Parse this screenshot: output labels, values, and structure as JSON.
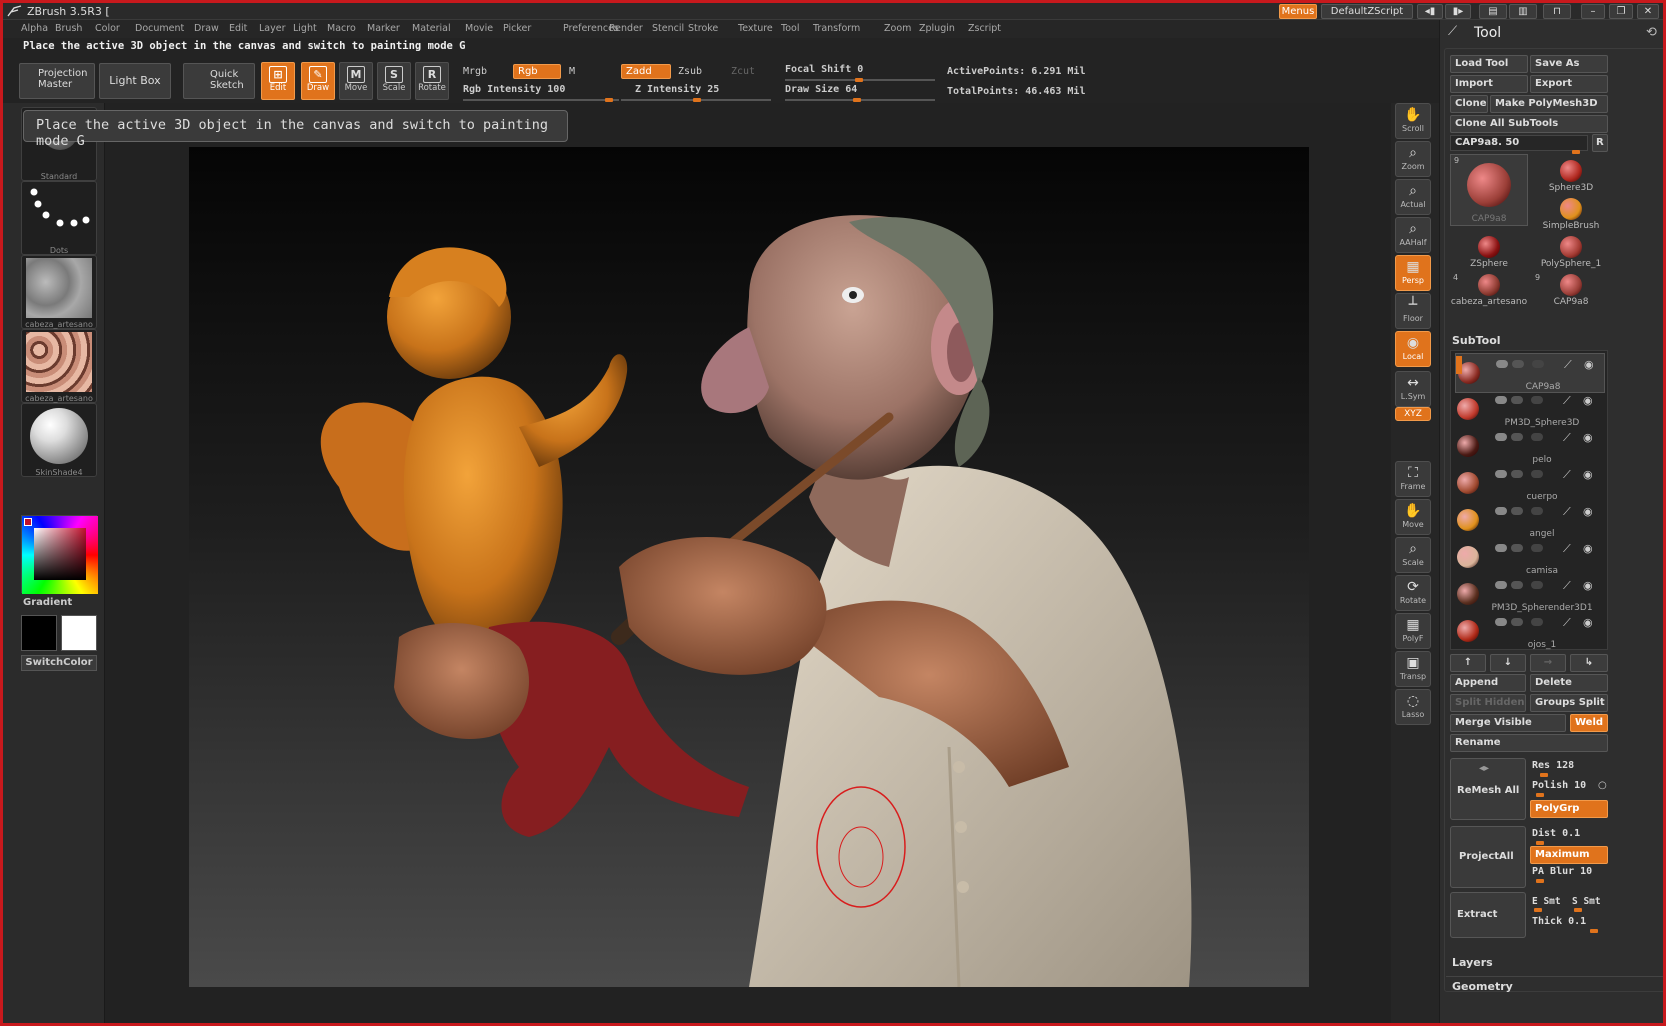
{
  "app": {
    "title": "ZBrush 3.5R3 ["
  },
  "titlebar": {
    "menus": "Menus",
    "script": "DefaultZScript"
  },
  "menubar": [
    "Alpha",
    "Brush",
    "Color",
    "Document",
    "Draw",
    "Edit",
    "Layer",
    "Light",
    "Macro",
    "Marker",
    "Material",
    "Movie",
    "Picker",
    "Preferences",
    "Render",
    "Stencil",
    "Stroke",
    "Texture",
    "Tool",
    "Transform",
    "Zoom",
    "Zplugin",
    "Zscript"
  ],
  "hint": "Place the active 3D object in the canvas and switch to painting mode  G",
  "tooltip": "Place the active 3D object in the canvas and switch to painting mode  G",
  "toolbar": {
    "projection_master": "Projection Master",
    "light_box": "Light Box",
    "quick_sketch": "Quick Sketch",
    "tools": [
      {
        "label": "Edit",
        "glyph": "⊞",
        "active": true
      },
      {
        "label": "Draw",
        "glyph": "✎",
        "active": true
      },
      {
        "label": "Move",
        "glyph": "M",
        "active": false
      },
      {
        "label": "Scale",
        "glyph": "S",
        "active": false
      },
      {
        "label": "Rotate",
        "glyph": "R",
        "active": false
      }
    ],
    "mrgb": "Mrgb",
    "rgb": "Rgb",
    "m": "M",
    "rgb_intensity": "Rgb Intensity 100",
    "zadd": "Zadd",
    "zsub": "Zsub",
    "zcut": "Zcut",
    "z_intensity": "Z Intensity 25",
    "focal_shift": "Focal Shift 0",
    "draw_size": "Draw Size 64",
    "active_points": "ActivePoints: 6.291 Mil",
    "total_points": "TotalPoints: 46.463 Mil"
  },
  "left_shelf": [
    {
      "caption": "Standard",
      "kind": "brush"
    },
    {
      "caption": "Dots",
      "kind": "dots"
    },
    {
      "caption": "cabeza_artesano",
      "kind": "texture-grey"
    },
    {
      "caption": "cabeza_artesano",
      "kind": "texture-skin"
    },
    {
      "caption": "SkinShade4",
      "kind": "material"
    }
  ],
  "color": {
    "gradient_label": "Gradient",
    "switch_label": "SwitchColor",
    "primary": "#000000",
    "secondary": "#ffffff"
  },
  "right_strip": [
    {
      "label": "Scroll",
      "glyph": "✋",
      "active": false
    },
    {
      "label": "Zoom",
      "glyph": "⌕",
      "active": false
    },
    {
      "label": "Actual",
      "glyph": "⌕",
      "active": false
    },
    {
      "label": "AAHalf",
      "glyph": "⌕",
      "active": false
    },
    {
      "label": "Persp",
      "glyph": "▦",
      "active": true
    },
    {
      "label": "Floor",
      "glyph": "┴",
      "active": false
    },
    {
      "label": "Local",
      "glyph": "◉",
      "active": true
    },
    {
      "label": "L.Sym",
      "glyph": "↔",
      "active": false
    },
    {
      "label": "XYZ",
      "glyph": "",
      "active": true
    },
    {
      "label": "Frame",
      "glyph": "⛶",
      "active": false
    },
    {
      "label": "Move",
      "glyph": "✋",
      "active": false
    },
    {
      "label": "Scale",
      "glyph": "⌕",
      "active": false
    },
    {
      "label": "Rotate",
      "glyph": "⟳",
      "active": false
    },
    {
      "label": "PolyF",
      "glyph": "▦",
      "active": false
    },
    {
      "label": "Transp",
      "glyph": "▣",
      "active": false
    },
    {
      "label": "Lasso",
      "glyph": "◌",
      "active": false
    }
  ],
  "tool_panel": {
    "title": "Tool",
    "load_tool": "Load Tool",
    "save_as": "Save As",
    "import": "Import",
    "export": "Export",
    "clone": "Clone",
    "make_polymesh": "Make PolyMesh3D",
    "clone_all": "Clone All SubTools",
    "current": "CAP9a8. 50",
    "r": "R",
    "thumbs": [
      {
        "name": "CAP9a8",
        "count": "9"
      },
      {
        "name": "Sphere3D",
        "count": ""
      },
      {
        "name": "SimpleBrush",
        "count": ""
      },
      {
        "name": "ZSphere",
        "count": ""
      },
      {
        "name": "PolySphere_1",
        "count": ""
      },
      {
        "name": "cabeza_artesano",
        "count": "4"
      },
      {
        "name": "CAP9a8",
        "count": "9"
      }
    ]
  },
  "subtool": {
    "title": "SubTool",
    "items": [
      "CAP9a8",
      "PM3D_Sphere3D",
      "pelo",
      "cuerpo",
      "angel",
      "camisa",
      "PM3D_Spherender3D1",
      "ojos_1"
    ],
    "append": "Append",
    "delete": "Delete",
    "split_hidden": "Split Hidden",
    "groups_split": "Groups Split",
    "merge_visible": "Merge Visible",
    "weld": "Weld",
    "rename": "Rename",
    "remesh_all": "ReMesh All",
    "res": "Res 128",
    "polish": "Polish 10",
    "polygrp": "PolyGrp",
    "project_all": "ProjectAll",
    "dist": "Dist 0.1",
    "maximum": "Maximum",
    "pa_blur": "PA Blur 10",
    "extract": "Extract",
    "e_smt": "E Smt",
    "s_smt": "S Smt",
    "thick": "Thick 0.1"
  },
  "sections": {
    "layers": "Layers",
    "geometry": "Geometry"
  }
}
